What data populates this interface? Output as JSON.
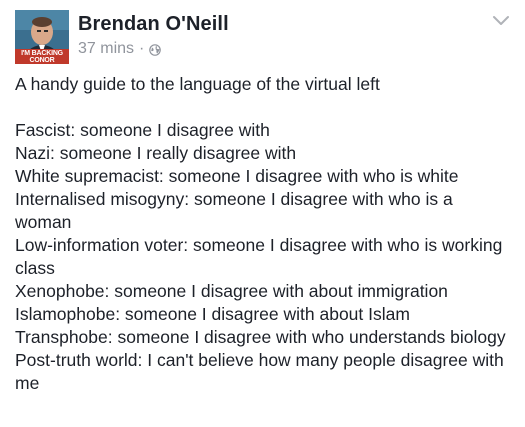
{
  "author": {
    "name": "Brendan O'Neill",
    "avatar_badge_line1": "I'M BACKING",
    "avatar_badge_line2": "CONOR"
  },
  "meta": {
    "timestamp": "37 mins",
    "separator": "·",
    "privacy_icon": "globe-icon"
  },
  "menu": {
    "icon": "chevron-down-icon"
  },
  "post": {
    "intro": "A handy guide to the language of the virtual left",
    "lines": [
      "Fascist: someone I disagree with",
      "Nazi: someone I really disagree with",
      "White supremacist: someone I disagree with who is white",
      "Internalised misogyny: someone I disagree with who is a woman",
      "Low-information voter: someone I disagree with who is working class",
      "Xenophobe: someone I disagree with about immigration",
      "Islamophobe: someone I disagree with about Islam",
      "Transphobe: someone I disagree with who understands biology",
      "Post-truth world: I can't believe how many people disagree with me"
    ]
  },
  "colors": {
    "text": "#1d2129",
    "meta": "#90949c",
    "avatar_bg": "#2c5b7c",
    "badge": "#c0392b"
  }
}
